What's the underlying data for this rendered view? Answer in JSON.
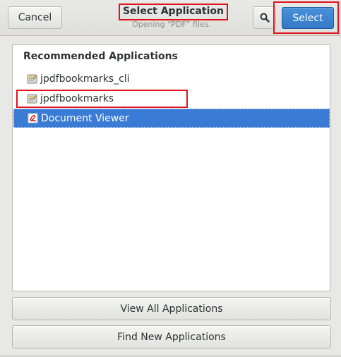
{
  "header": {
    "cancel_label": "Cancel",
    "title": "Select Application",
    "subtitle": "Opening “PDF” files.",
    "search_icon": "search-icon",
    "select_label": "Select"
  },
  "list": {
    "heading": "Recommended Applications",
    "items": [
      {
        "label": "jpdfbookmarks_cli",
        "icon": "generic-app-icon",
        "selected": false
      },
      {
        "label": "jpdfbookmarks",
        "icon": "generic-app-icon",
        "selected": false
      },
      {
        "label": "Document Viewer",
        "icon": "document-viewer-icon",
        "selected": true
      }
    ]
  },
  "footer": {
    "view_all_label": "View All Applications",
    "find_new_label": "Find New Applications"
  },
  "colors": {
    "accent": "#3a7bd5",
    "annotation_red": "#e0141d"
  }
}
